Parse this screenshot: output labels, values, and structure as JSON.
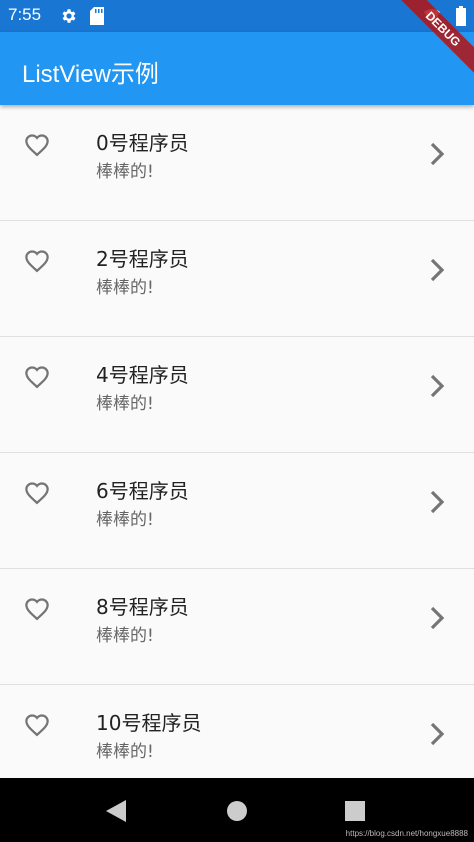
{
  "status_bar": {
    "time": "7:55"
  },
  "app_bar": {
    "title": "ListView示例"
  },
  "debug_banner": "DEBUG",
  "list": {
    "items": [
      {
        "title": "0号程序员",
        "subtitle": "棒棒的!"
      },
      {
        "title": "2号程序员",
        "subtitle": "棒棒的!"
      },
      {
        "title": "4号程序员",
        "subtitle": "棒棒的!"
      },
      {
        "title": "6号程序员",
        "subtitle": "棒棒的!"
      },
      {
        "title": "8号程序员",
        "subtitle": "棒棒的!"
      },
      {
        "title": "10号程序员",
        "subtitle": "棒棒的!"
      }
    ]
  },
  "watermark": "https://blog.csdn.net/hongxue8888",
  "colors": {
    "app_bar": "#2196f3",
    "status_bar": "#1976d2",
    "icon": "#757575"
  }
}
